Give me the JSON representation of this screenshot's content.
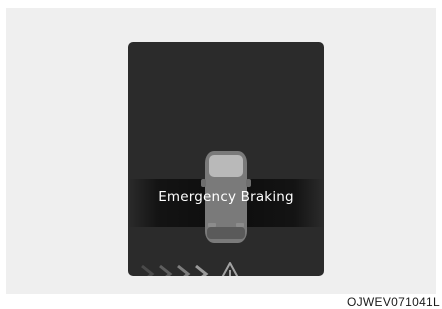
{
  "display": {
    "message": "Emergency Braking"
  },
  "figure": {
    "code": "OJWEV071041L"
  },
  "icons": {
    "vehicle": "car-rear-view-icon",
    "direction": "chevron-right-icon",
    "warning": "warning-triangle-icon"
  },
  "colors": {
    "frame_background": "#efefef",
    "screen_background": "#2b2b2b",
    "message_text": "#ffffff",
    "chevron_active": "#9a9a9a",
    "chevron_inactive": "#4a4a4a"
  }
}
